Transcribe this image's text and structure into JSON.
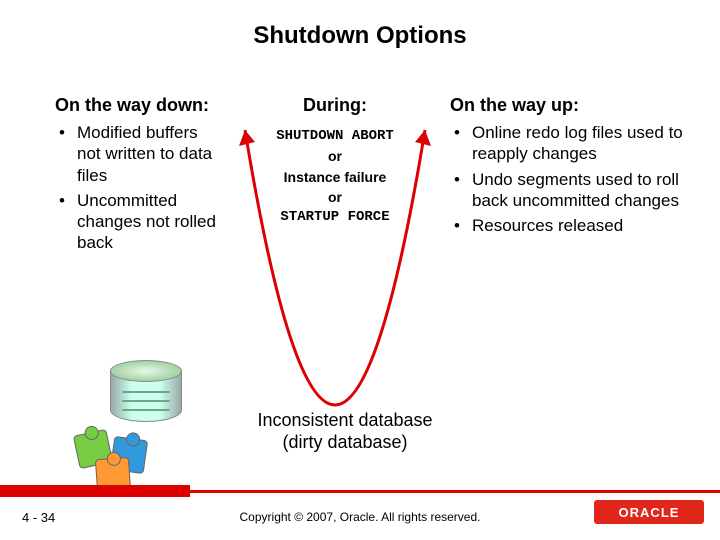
{
  "title": "Shutdown Options",
  "left": {
    "heading": "On the way down:",
    "items": [
      "Modified buffers not written to data files",
      "Uncommitted changes not rolled back"
    ]
  },
  "mid": {
    "heading": "During:",
    "l1": "SHUTDOWN ABORT",
    "l2": "or",
    "l3": "Instance failure",
    "l4": "or",
    "l5": "STARTUP FORCE"
  },
  "right": {
    "heading": "On the way up:",
    "items": [
      "Online redo log files used to reapply changes",
      "Undo segments used to roll back uncommitted changes",
      "Resources released"
    ]
  },
  "inconsistent": {
    "l1": "Inconsistent database",
    "l2": "(dirty database)"
  },
  "footer": {
    "page": "4 - 34",
    "copyright": "Copyright © 2007, Oracle. All rights reserved.",
    "logo_text": "ORACLE"
  }
}
